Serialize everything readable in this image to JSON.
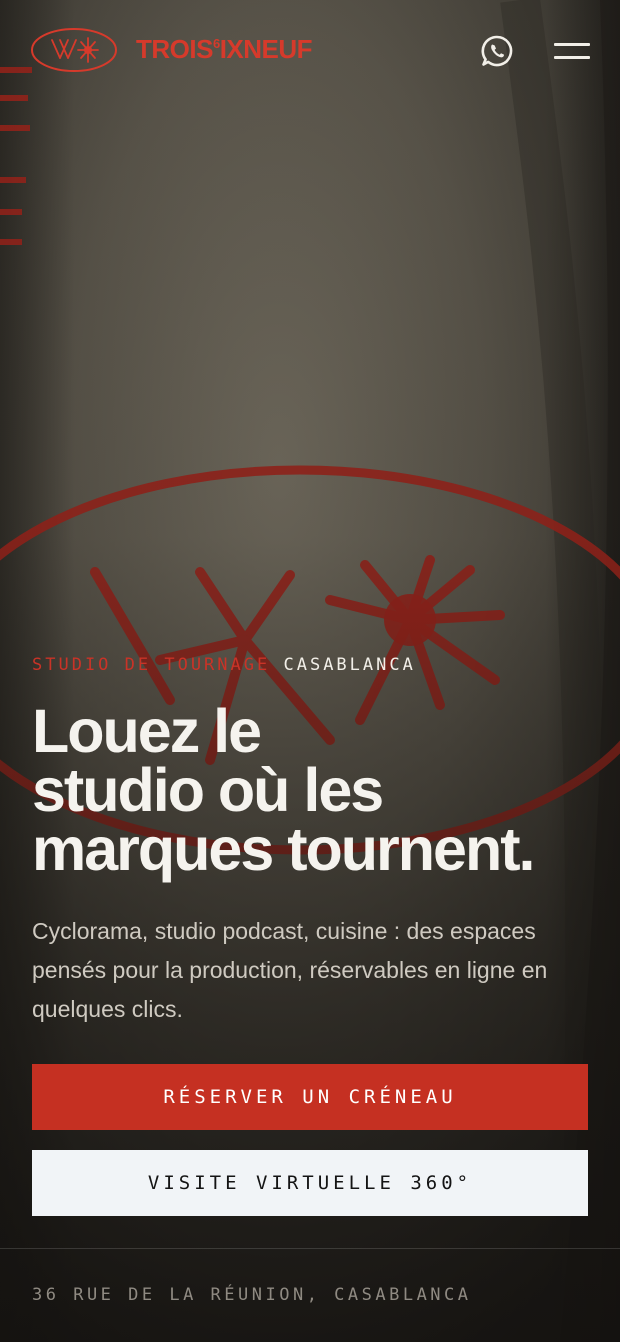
{
  "header": {
    "logo_text_a": "TROIS",
    "logo_text_sup": "6",
    "logo_text_b": "IXNEUF",
    "whatsapp_icon": "whatsapp-icon",
    "menu_icon": "hamburger-menu-icon"
  },
  "hero": {
    "eyebrow_red": "STUDIO DE TOURNAGE",
    "eyebrow_white": "CASABLANCA",
    "headline_lines": [
      "Louez le",
      "studio où les",
      "marques tournent."
    ],
    "subtext": "Cyclorama, studio podcast, cuisine : des espaces pensés pour la production, réservables en ligne en quelques clics.",
    "primary_cta": "RÉSERVER UN CRÉNEAU",
    "secondary_cta": "VISITE VIRTUELLE 360°"
  },
  "footer": {
    "address": "36 RUE DE LA RÉUNION, CASABLANCA"
  },
  "colors": {
    "brand_red": "#c53022",
    "text_light": "#f2efe8",
    "button_light": "#f1f4f7"
  }
}
